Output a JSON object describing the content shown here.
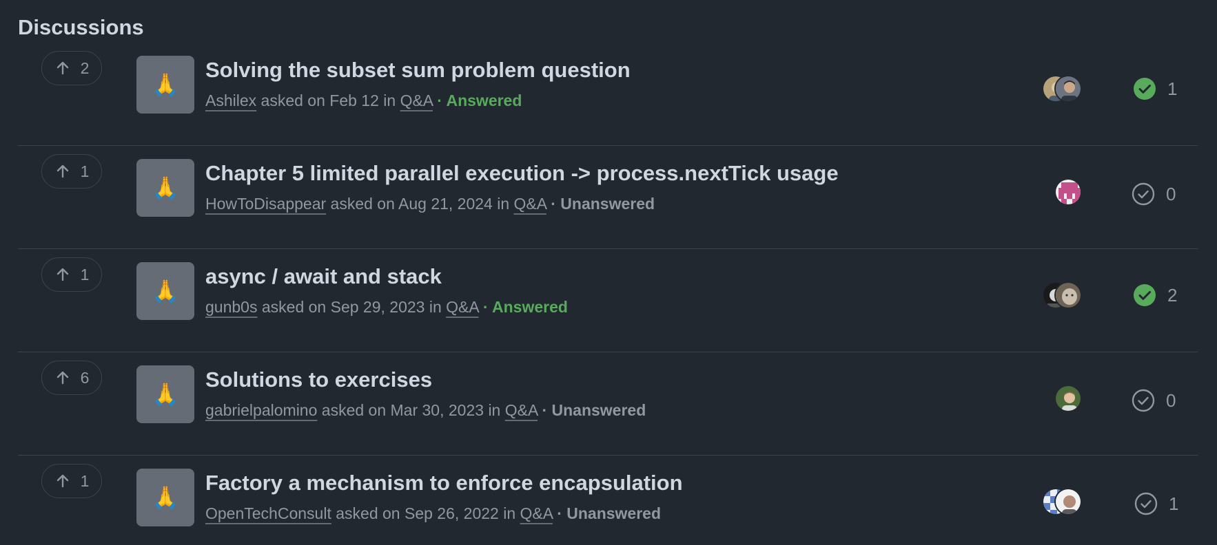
{
  "heading": "Discussions",
  "discussions": [
    {
      "votes": "2",
      "emoji": "🙏",
      "title": "Solving the subset sum problem question",
      "author": "Ashilex",
      "asked_text": "asked on Feb 12 in",
      "category": "Q&A",
      "status": "· Answered",
      "answered": true,
      "answer_count": "1"
    },
    {
      "votes": "1",
      "emoji": "🙏",
      "title": "Chapter 5 limited parallel execution -> process.nextTick usage",
      "author": "HowToDisappear",
      "asked_text": "asked on Aug 21, 2024 in",
      "category": "Q&A",
      "status": "· Unanswered",
      "answered": false,
      "answer_count": "0"
    },
    {
      "votes": "1",
      "emoji": "🙏",
      "title": "async / await and stack",
      "author": "gunb0s",
      "asked_text": "asked on Sep 29, 2023 in",
      "category": "Q&A",
      "status": "· Answered",
      "answered": true,
      "answer_count": "2"
    },
    {
      "votes": "6",
      "emoji": "🙏",
      "title": "Solutions to exercises",
      "author": "gabrielpalomino",
      "asked_text": "asked on Mar 30, 2023 in",
      "category": "Q&A",
      "status": "· Unanswered",
      "answered": false,
      "answer_count": "0"
    },
    {
      "votes": "1",
      "emoji": "🙏",
      "title": "Factory a mechanism to enforce encapsulation",
      "author": "OpenTechConsult",
      "asked_text": "asked on Sep 26, 2022 in",
      "category": "Q&A",
      "status": "· Unanswered",
      "answered": false,
      "answer_count": "1"
    }
  ],
  "colors": {
    "background": "#212830",
    "answered_green": "#57ab5a",
    "muted_text": "#9198a1",
    "title_text": "#d1d7e0"
  }
}
